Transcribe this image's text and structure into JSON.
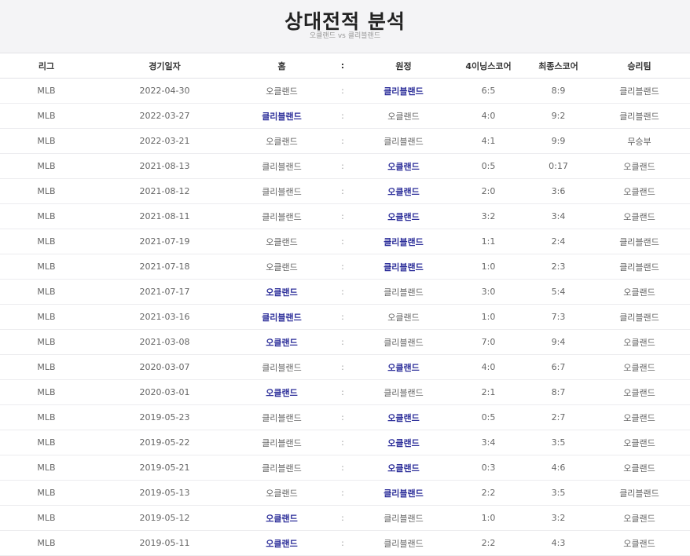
{
  "page": {
    "title": "상대전적 분석",
    "subtitle": "오클랜드 vs 클리블랜드"
  },
  "columns": {
    "league": "리그",
    "date": "경기일자",
    "home": "홈",
    "sep": ":",
    "away": "원정",
    "inning4": "4이닝스코어",
    "final": "최종스코어",
    "winner": "승리팀"
  },
  "colors": {
    "highlight": "#2d2f9a",
    "header_bg": "#f4f4f6"
  },
  "rows": [
    {
      "league": "MLB",
      "date": "2022-04-30",
      "home": "오클랜드",
      "away": "클리블랜드",
      "inning4": "6:5",
      "final": "8:9",
      "winner": "클리블랜드",
      "highlight": "away"
    },
    {
      "league": "MLB",
      "date": "2022-03-27",
      "home": "클리블랜드",
      "away": "오클랜드",
      "inning4": "4:0",
      "final": "9:2",
      "winner": "클리블랜드",
      "highlight": "home"
    },
    {
      "league": "MLB",
      "date": "2022-03-21",
      "home": "오클랜드",
      "away": "클리블랜드",
      "inning4": "4:1",
      "final": "9:9",
      "winner": "무승부",
      "highlight": "none"
    },
    {
      "league": "MLB",
      "date": "2021-08-13",
      "home": "클리블랜드",
      "away": "오클랜드",
      "inning4": "0:5",
      "final": "0:17",
      "winner": "오클랜드",
      "highlight": "away"
    },
    {
      "league": "MLB",
      "date": "2021-08-12",
      "home": "클리블랜드",
      "away": "오클랜드",
      "inning4": "2:0",
      "final": "3:6",
      "winner": "오클랜드",
      "highlight": "away"
    },
    {
      "league": "MLB",
      "date": "2021-08-11",
      "home": "클리블랜드",
      "away": "오클랜드",
      "inning4": "3:2",
      "final": "3:4",
      "winner": "오클랜드",
      "highlight": "away"
    },
    {
      "league": "MLB",
      "date": "2021-07-19",
      "home": "오클랜드",
      "away": "클리블랜드",
      "inning4": "1:1",
      "final": "2:4",
      "winner": "클리블랜드",
      "highlight": "away"
    },
    {
      "league": "MLB",
      "date": "2021-07-18",
      "home": "오클랜드",
      "away": "클리블랜드",
      "inning4": "1:0",
      "final": "2:3",
      "winner": "클리블랜드",
      "highlight": "away"
    },
    {
      "league": "MLB",
      "date": "2021-07-17",
      "home": "오클랜드",
      "away": "클리블랜드",
      "inning4": "3:0",
      "final": "5:4",
      "winner": "오클랜드",
      "highlight": "home"
    },
    {
      "league": "MLB",
      "date": "2021-03-16",
      "home": "클리블랜드",
      "away": "오클랜드",
      "inning4": "1:0",
      "final": "7:3",
      "winner": "클리블랜드",
      "highlight": "home"
    },
    {
      "league": "MLB",
      "date": "2021-03-08",
      "home": "오클랜드",
      "away": "클리블랜드",
      "inning4": "7:0",
      "final": "9:4",
      "winner": "오클랜드",
      "highlight": "home"
    },
    {
      "league": "MLB",
      "date": "2020-03-07",
      "home": "클리블랜드",
      "away": "오클랜드",
      "inning4": "4:0",
      "final": "6:7",
      "winner": "오클랜드",
      "highlight": "away"
    },
    {
      "league": "MLB",
      "date": "2020-03-01",
      "home": "오클랜드",
      "away": "클리블랜드",
      "inning4": "2:1",
      "final": "8:7",
      "winner": "오클랜드",
      "highlight": "home"
    },
    {
      "league": "MLB",
      "date": "2019-05-23",
      "home": "클리블랜드",
      "away": "오클랜드",
      "inning4": "0:5",
      "final": "2:7",
      "winner": "오클랜드",
      "highlight": "away"
    },
    {
      "league": "MLB",
      "date": "2019-05-22",
      "home": "클리블랜드",
      "away": "오클랜드",
      "inning4": "3:4",
      "final": "3:5",
      "winner": "오클랜드",
      "highlight": "away"
    },
    {
      "league": "MLB",
      "date": "2019-05-21",
      "home": "클리블랜드",
      "away": "오클랜드",
      "inning4": "0:3",
      "final": "4:6",
      "winner": "오클랜드",
      "highlight": "away"
    },
    {
      "league": "MLB",
      "date": "2019-05-13",
      "home": "오클랜드",
      "away": "클리블랜드",
      "inning4": "2:2",
      "final": "3:5",
      "winner": "클리블랜드",
      "highlight": "away"
    },
    {
      "league": "MLB",
      "date": "2019-05-12",
      "home": "오클랜드",
      "away": "클리블랜드",
      "inning4": "1:0",
      "final": "3:2",
      "winner": "오클랜드",
      "highlight": "home"
    },
    {
      "league": "MLB",
      "date": "2019-05-11",
      "home": "오클랜드",
      "away": "클리블랜드",
      "inning4": "2:2",
      "final": "4:3",
      "winner": "오클랜드",
      "highlight": "home"
    }
  ]
}
